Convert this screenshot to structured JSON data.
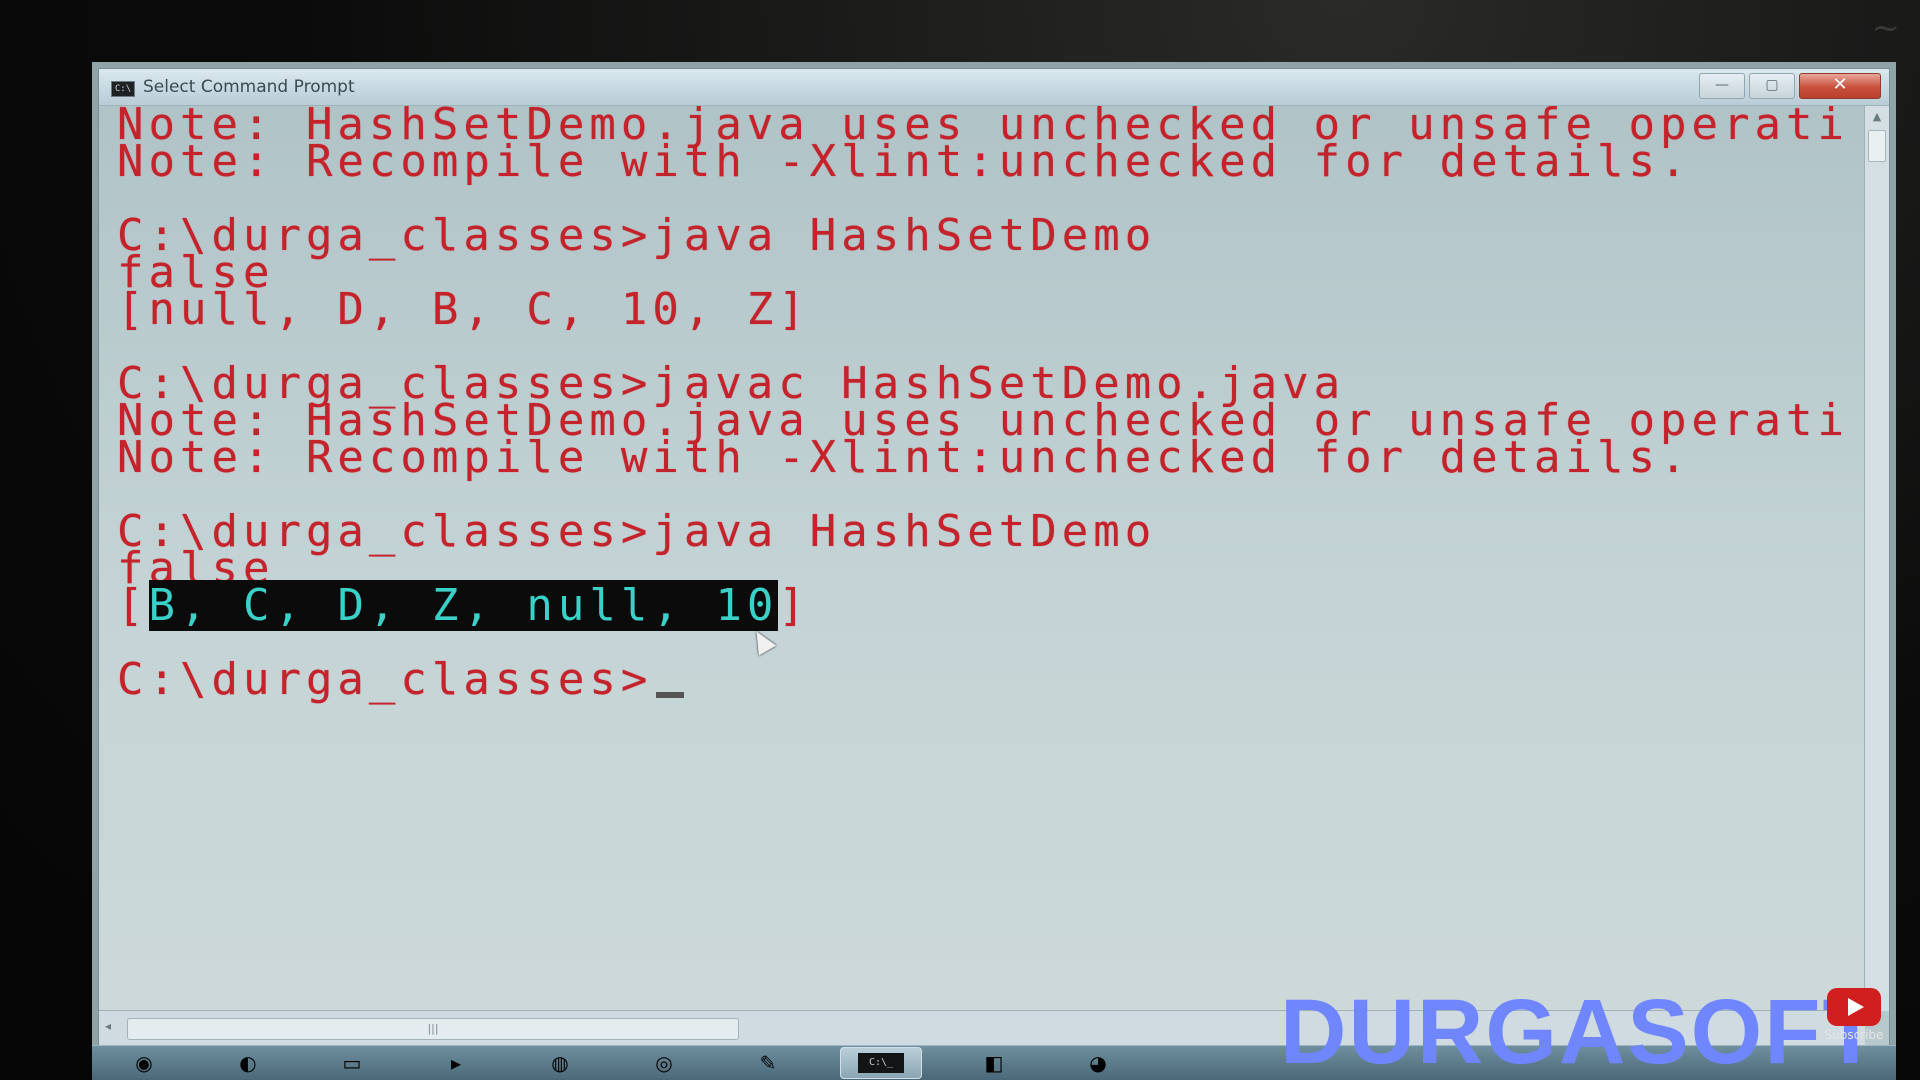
{
  "window": {
    "title": "Select Command Prompt",
    "icon_label": "C:\\",
    "minimize_label": "—",
    "maximize_label": "▢",
    "close_label": "✕"
  },
  "console": {
    "lines": [
      {
        "text": "Note: HashSetDemo.java uses unchecked or unsafe operati"
      },
      {
        "text": "Note: Recompile with -Xlint:unchecked for details."
      },
      {
        "text": ""
      },
      {
        "text": "C:\\durga_classes>java HashSetDemo"
      },
      {
        "text": "false"
      },
      {
        "text": "[null, D, B, C, 10, Z]"
      },
      {
        "text": ""
      },
      {
        "text": "C:\\durga_classes>javac HashSetDemo.java"
      },
      {
        "text": "Note: HashSetDemo.java uses unchecked or unsafe operati"
      },
      {
        "text": "Note: Recompile with -Xlint:unchecked for details."
      },
      {
        "text": ""
      },
      {
        "text": "C:\\durga_classes>java HashSetDemo"
      },
      {
        "text": "false"
      },
      {
        "text": "[B, C, D, Z, null, 10]",
        "selected": "B, C, D, Z, null, 10"
      },
      {
        "text": ""
      },
      {
        "text": "C:\\durga_classes>",
        "cursor": true
      }
    ]
  },
  "scrollbar": {
    "up_arrow": "▲",
    "left_arrow": "◂",
    "h_thumb_grip": "|||"
  },
  "taskbar": {
    "active_item_label": "C:\\_"
  },
  "watermark": {
    "text": "DURGASOFT"
  },
  "subscribe": {
    "label": "Subscribe"
  },
  "colors": {
    "console_text": "#c4232b",
    "selection_text": "#39d1c8",
    "selection_bg": "#0b0b0b",
    "watermark": "#6f86ff"
  }
}
